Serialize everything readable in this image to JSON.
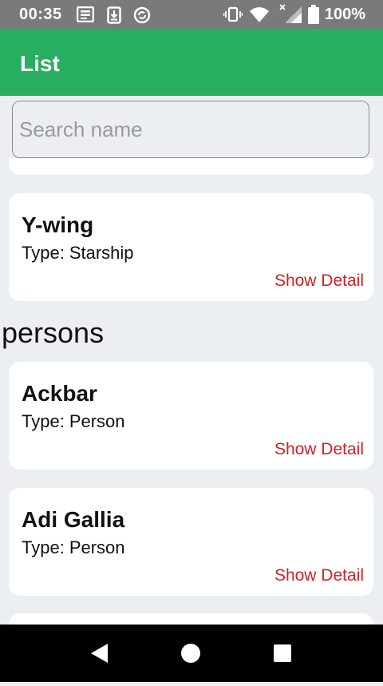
{
  "status_bar": {
    "time": "00:35",
    "battery_text": "100%",
    "icons": [
      "news-icon",
      "download-icon",
      "sync-icon",
      "vibrate-icon",
      "wifi-icon",
      "signal-icon",
      "battery-icon"
    ]
  },
  "app_bar": {
    "title": "List",
    "color": "#27ae60"
  },
  "search": {
    "placeholder": "Search name",
    "value": ""
  },
  "cards": [
    {
      "name": "Y-wing",
      "type_label": "Type:",
      "type_value": "Starship",
      "action": "Show Detail"
    },
    {
      "name": "Ackbar",
      "type_label": "Type:",
      "type_value": "Person",
      "action": "Show Detail"
    },
    {
      "name": "Adi Gallia",
      "type_label": "Type:",
      "type_value": "Person",
      "action": "Show Detail"
    }
  ],
  "section": {
    "title": "persons"
  },
  "nav_bar": {
    "icons": [
      "back-icon",
      "home-icon",
      "recents-icon"
    ]
  },
  "colors": {
    "link": "#d32020",
    "background": "#eceff1"
  }
}
